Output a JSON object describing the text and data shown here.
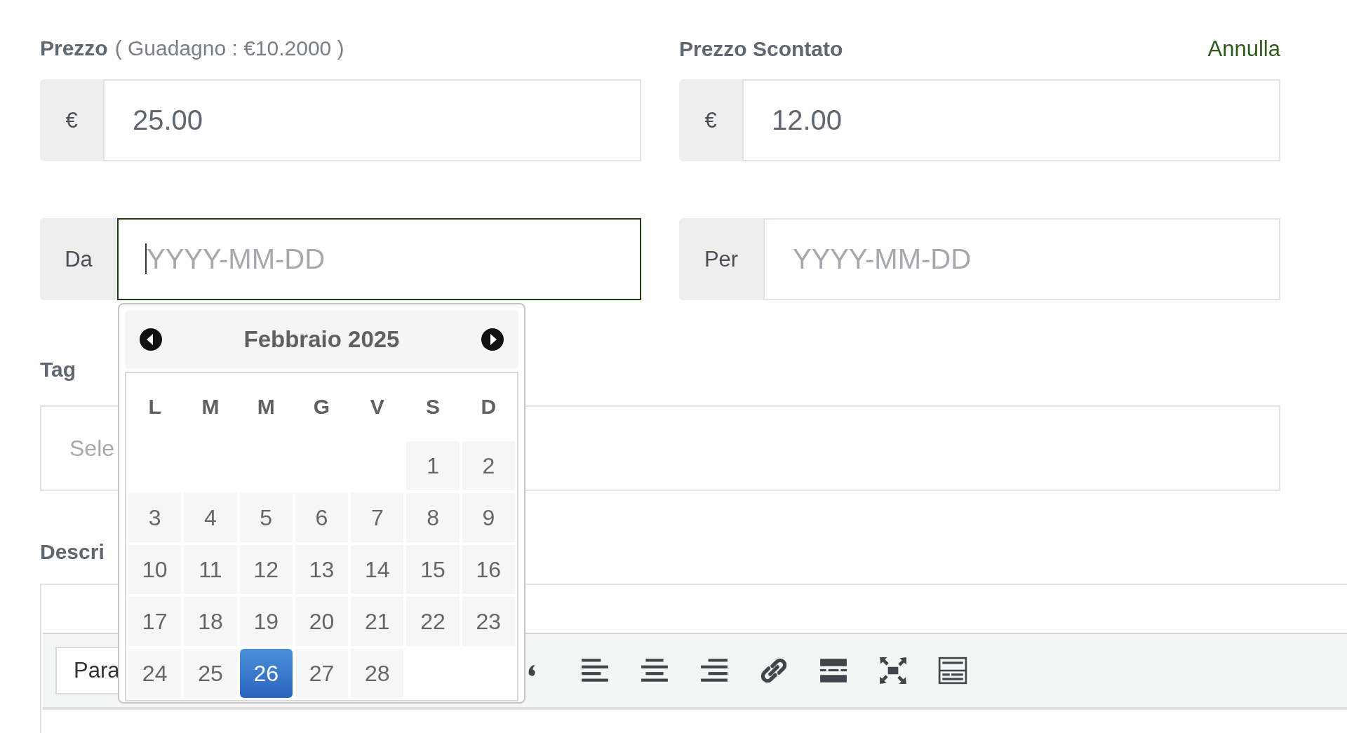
{
  "price": {
    "label": "Prezzo",
    "note": "( Guadagno : €10.2000 )",
    "addon": "€",
    "value": "25.00"
  },
  "discount": {
    "label": "Prezzo Scontato",
    "action": "Annulla",
    "addon": "€",
    "value": "12.00"
  },
  "date_from": {
    "addon": "Da",
    "placeholder": "YYYY-MM-DD",
    "focused": true
  },
  "date_to": {
    "addon": "Per",
    "placeholder": "YYYY-MM-DD",
    "focused": false
  },
  "tags": {
    "label": "Tag",
    "placeholder": "Sele"
  },
  "description": {
    "label": "Descri",
    "format_select": "Para"
  },
  "calendar": {
    "title": "Febbraio 2025",
    "weekdays": [
      "L",
      "M",
      "M",
      "G",
      "V",
      "S",
      "D"
    ],
    "weeks": [
      [
        {
          "kind": "empty"
        },
        {
          "kind": "empty"
        },
        {
          "kind": "empty"
        },
        {
          "kind": "empty"
        },
        {
          "kind": "empty"
        },
        {
          "kind": "day",
          "day": "1",
          "selected": false
        },
        {
          "kind": "day",
          "day": "2",
          "selected": false
        }
      ],
      [
        {
          "kind": "day",
          "day": "3",
          "selected": false
        },
        {
          "kind": "day",
          "day": "4",
          "selected": false
        },
        {
          "kind": "day",
          "day": "5",
          "selected": false
        },
        {
          "kind": "day",
          "day": "6",
          "selected": false
        },
        {
          "kind": "day",
          "day": "7",
          "selected": false
        },
        {
          "kind": "day",
          "day": "8",
          "selected": false
        },
        {
          "kind": "day",
          "day": "9",
          "selected": false
        }
      ],
      [
        {
          "kind": "day",
          "day": "10",
          "selected": false
        },
        {
          "kind": "day",
          "day": "11",
          "selected": false
        },
        {
          "kind": "day",
          "day": "12",
          "selected": false
        },
        {
          "kind": "day",
          "day": "13",
          "selected": false
        },
        {
          "kind": "day",
          "day": "14",
          "selected": false
        },
        {
          "kind": "day",
          "day": "15",
          "selected": false
        },
        {
          "kind": "day",
          "day": "16",
          "selected": false
        }
      ],
      [
        {
          "kind": "day",
          "day": "17",
          "selected": false
        },
        {
          "kind": "day",
          "day": "18",
          "selected": false
        },
        {
          "kind": "day",
          "day": "19",
          "selected": false
        },
        {
          "kind": "day",
          "day": "20",
          "selected": false
        },
        {
          "kind": "day",
          "day": "21",
          "selected": false
        },
        {
          "kind": "day",
          "day": "22",
          "selected": false
        },
        {
          "kind": "day",
          "day": "23",
          "selected": false
        }
      ],
      [
        {
          "kind": "day",
          "day": "24",
          "selected": false
        },
        {
          "kind": "day",
          "day": "25",
          "selected": false
        },
        {
          "kind": "day",
          "day": "26",
          "selected": true
        },
        {
          "kind": "day",
          "day": "27",
          "selected": false
        },
        {
          "kind": "day",
          "day": "28",
          "selected": false
        },
        {
          "kind": "empty"
        },
        {
          "kind": "empty"
        }
      ]
    ]
  }
}
